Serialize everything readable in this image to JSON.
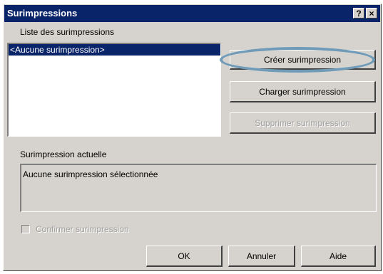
{
  "window": {
    "title": "Surimpressions",
    "help_glyph": "?",
    "close_glyph": "×"
  },
  "overlays": {
    "list_label": "Liste des surimpressions",
    "items": [
      "<Aucune surimpression>"
    ],
    "selected_index": 0,
    "create_button": "Créer surimpression",
    "load_button": "Charger surimpression",
    "delete_button": "Supprimer surimpression"
  },
  "current": {
    "label": "Surimpression actuelle",
    "value": "Aucune surimpression sélectionnée"
  },
  "confirm": {
    "label": "Confirmer surimpression",
    "checked": false
  },
  "footer": {
    "ok": "OK",
    "cancel": "Annuler",
    "help": "Aide"
  },
  "colors": {
    "titlebar": "#0a246a",
    "dialog_bg": "#d6d3ce",
    "highlight_ring": "#6f9bb8"
  }
}
